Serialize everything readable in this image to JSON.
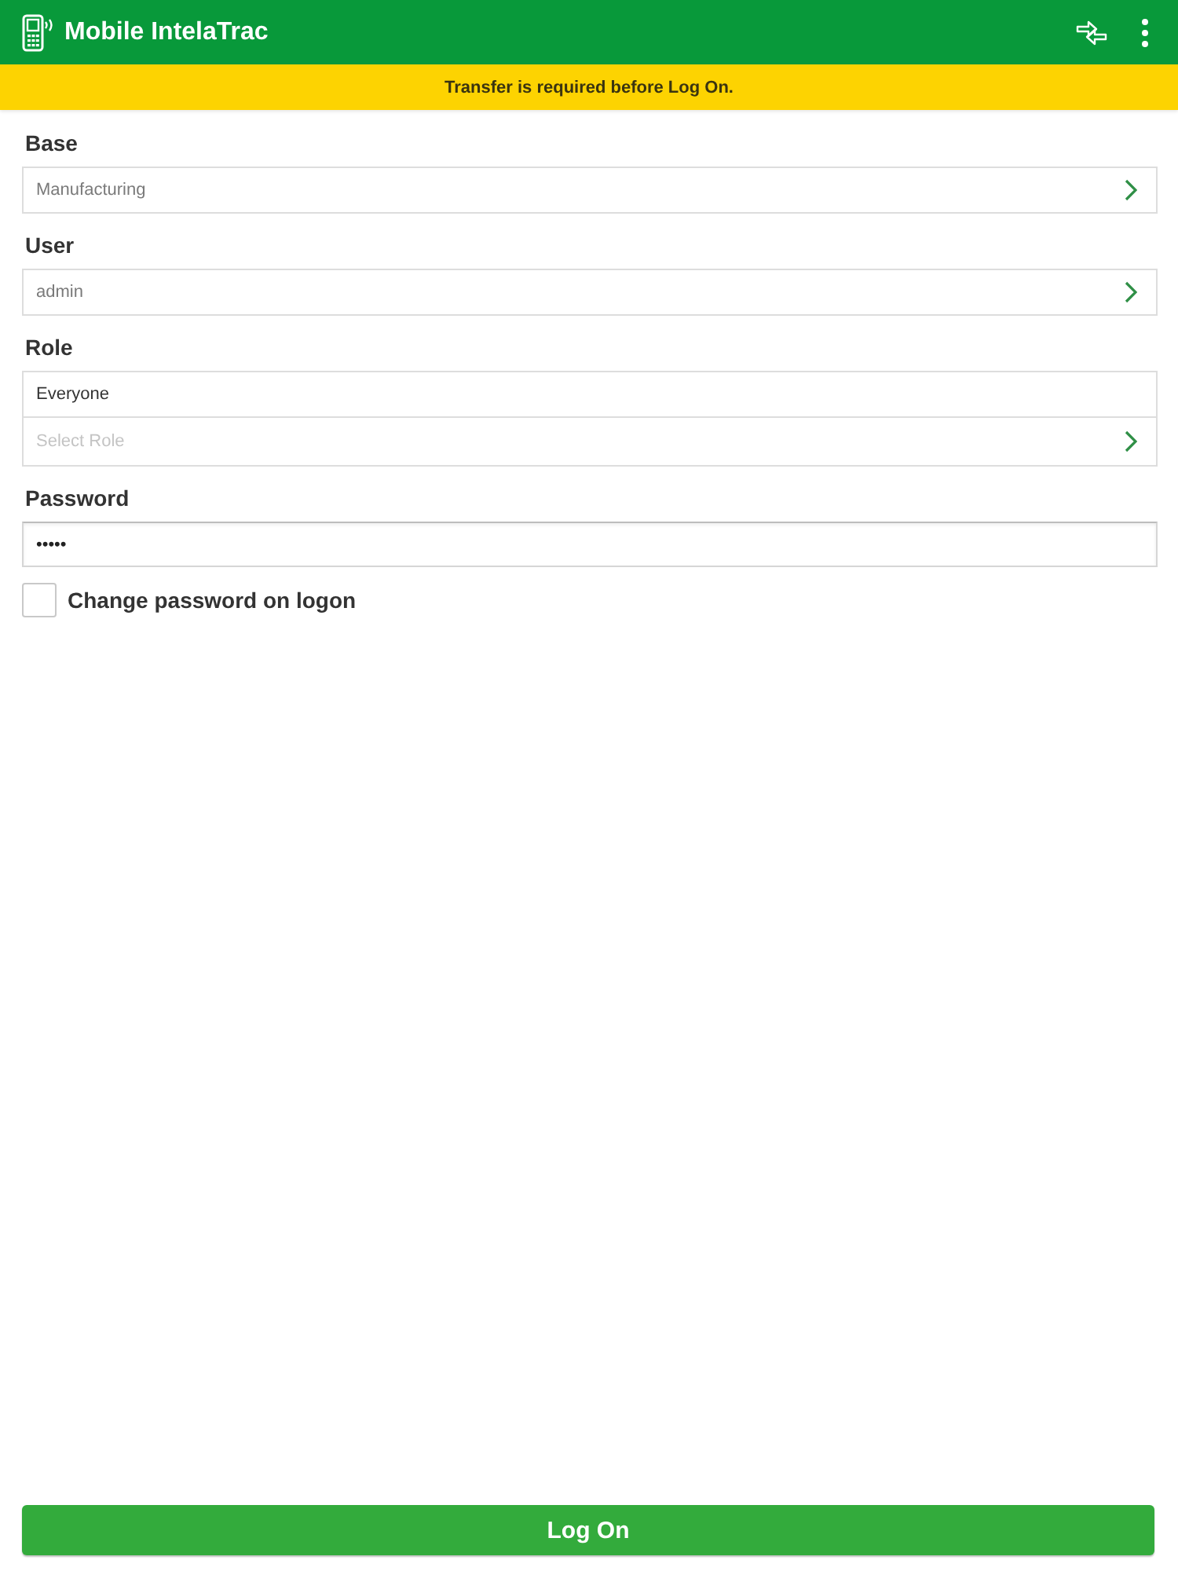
{
  "app_bar": {
    "title": "Mobile IntelaTrac"
  },
  "banner": {
    "message": "Transfer is required before Log On."
  },
  "fields": [
    {
      "label": "Base",
      "kind": "picker",
      "value": "Manufacturing"
    },
    {
      "label": "User",
      "kind": "picker",
      "value": "admin"
    },
    {
      "label": "Role",
      "kind": "role",
      "items": [
        "Everyone"
      ],
      "placeholder": "Select Role"
    },
    {
      "label": "Password",
      "kind": "password",
      "value": "•••••"
    }
  ],
  "change_password": {
    "label": "Change password on logon",
    "checked": false
  },
  "log_on_button": {
    "label": "Log On"
  }
}
